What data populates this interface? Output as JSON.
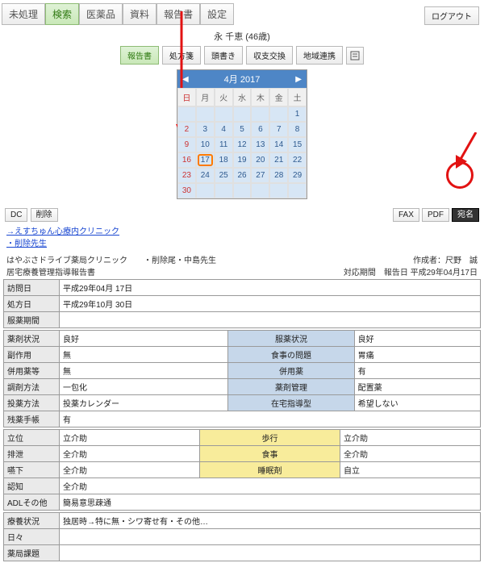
{
  "tabs": {
    "t0": "未処理",
    "t1": "検索",
    "t2": "医薬品",
    "t3": "資料",
    "t4": "報告書",
    "t5": "設定"
  },
  "logout": "ログアウト",
  "user_line": "永 千恵 (46歳)",
  "subbar": {
    "b0": "報告書",
    "b1": "処方箋",
    "b2": "頭書き",
    "b3": "収支交換",
    "b4": "地域連携"
  },
  "calendar": {
    "title": "4月 2017",
    "dow": [
      "日",
      "月",
      "火",
      "水",
      "木",
      "金",
      "土"
    ],
    "grid": [
      [
        "",
        "",
        "",
        "",
        "",
        "",
        "1"
      ],
      [
        "2",
        "3",
        "4",
        "5",
        "6",
        "7",
        "8"
      ],
      [
        "9",
        "10",
        "11",
        "12",
        "13",
        "14",
        "15"
      ],
      [
        "16",
        "17",
        "18",
        "19",
        "20",
        "21",
        "22"
      ],
      [
        "23",
        "24",
        "25",
        "26",
        "27",
        "28",
        "29"
      ],
      [
        "30",
        "",
        "",
        "",
        "",
        "",
        ""
      ]
    ]
  },
  "left_btns": {
    "dc": "DC",
    "del": "削除"
  },
  "right_btns": {
    "fax": "FAX",
    "pdf": "PDF",
    "atena": "宛名"
  },
  "links": {
    "l1": "→えすちゅん心療内クリニック",
    "l2": "・削除先生"
  },
  "doc": {
    "from": "はやぶさドライブ薬局クリニック　　・削除尾・中島先生",
    "title": "居宅療養管理指導報告書",
    "by": "作成者：尺野　誠",
    "period": "対応期間　報告日 平成29年04月17日"
  },
  "rows1": {
    "r1_h": "訪問日",
    "r1_v": "平成29年04月 17日",
    "r2_h": "処方日",
    "r2_v": "平成29年10月 30日",
    "r3_h": "服薬期間",
    "r3_v": ""
  },
  "rows2": {
    "a1_h": "薬剤状況",
    "a1_v": "良好",
    "a1_ch": "服薬状況",
    "a1_cv": "良好",
    "a2_h": "副作用",
    "a2_v": "無",
    "a2_ch": "食事の問題",
    "a2_cv": "胃痛",
    "a3_h": "併用薬等",
    "a3_v": "無",
    "a3_ch": "併用薬",
    "a3_cv": "有",
    "a4_h": "調剤方法",
    "a4_v": "一包化",
    "a4_ch": "薬剤管理",
    "a4_cv": "配置薬",
    "a5_h": "投薬方法",
    "a5_v": "投薬カレンダー",
    "a5_ch": "在宅指導型",
    "a5_cv": "希望しない",
    "a6_h": "残薬手帳",
    "a6_v": "有"
  },
  "rows3": {
    "b1_h": "立位",
    "b1_v": "立介助",
    "b1_ch": "歩行",
    "b1_cv": "立介助",
    "b2_h": "排泄",
    "b2_v": "全介助",
    "b2_ch": "食事",
    "b2_cv": "全介助",
    "b3_h": "嚥下",
    "b3_v": "全介助",
    "b3_ch": "睡眠剤",
    "b3_cv": "自立",
    "b4_h": "認知",
    "b4_v": "全介助",
    "b5_h": "ADLその他",
    "b5_v": "簡易意思疎通"
  },
  "rows4": {
    "c1_h": "療養状況",
    "c1_v": "独居時→特に無・シワ寄せ有・その他…",
    "c2_h": "日々",
    "c2_v": "",
    "c3_h": "薬局課題",
    "c3_v": ""
  }
}
